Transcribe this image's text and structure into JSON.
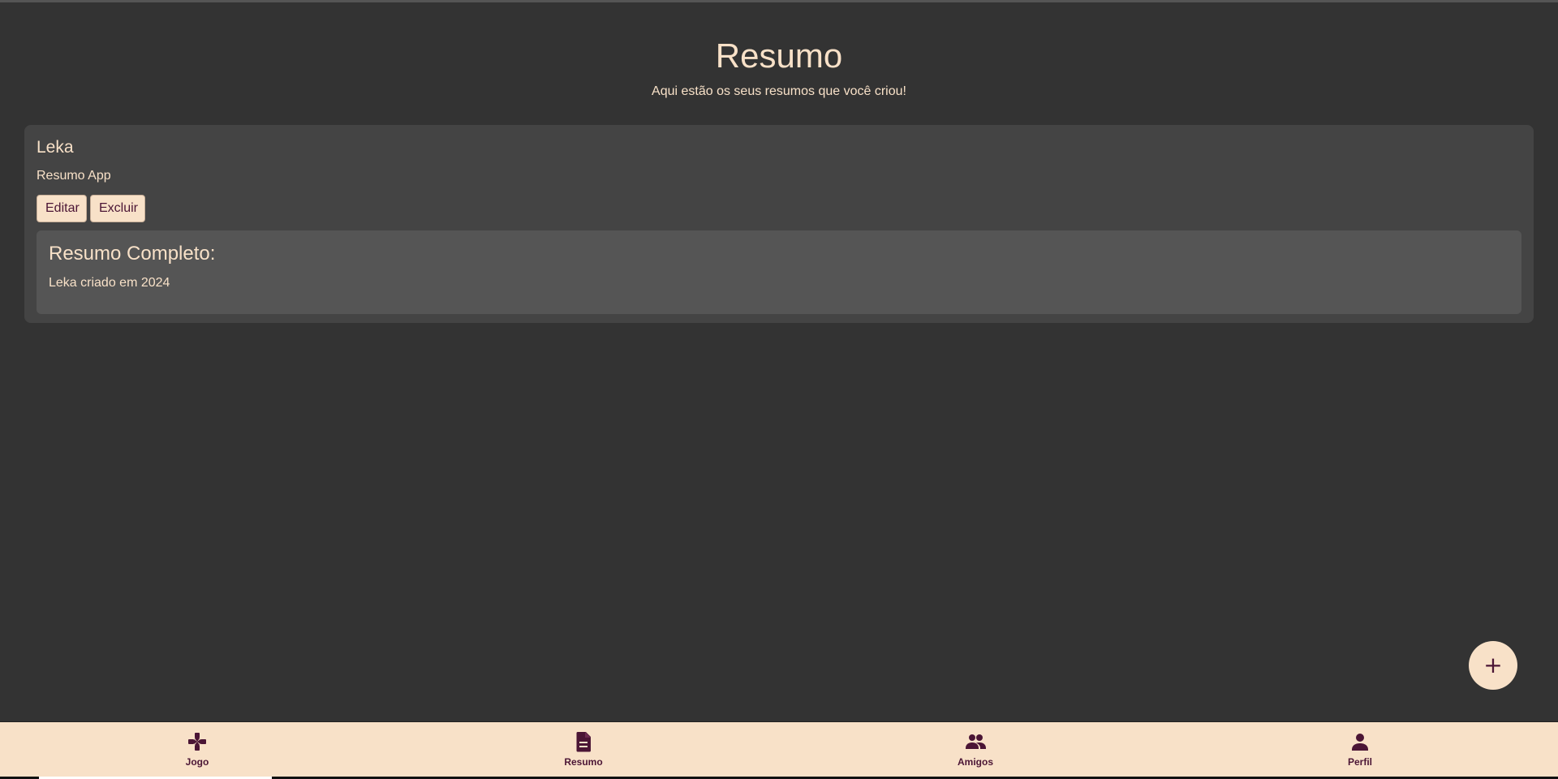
{
  "page": {
    "title": "Resumo",
    "subtitle": "Aqui estão os seus resumos que você criou!"
  },
  "summary_card": {
    "name": "Leka",
    "description": "Resumo App",
    "edit_label": "Editar",
    "delete_label": "Excluir",
    "detail_title": "Resumo Completo:",
    "detail_text": "Leka criado em 2024"
  },
  "fab": {
    "label": "+",
    "icon": "plus-icon"
  },
  "bottom_nav": {
    "items": [
      {
        "label": "Jogo",
        "icon": "gamepad-icon"
      },
      {
        "label": "Resumo",
        "icon": "document-icon"
      },
      {
        "label": "Amigos",
        "icon": "people-icon"
      },
      {
        "label": "Perfil",
        "icon": "person-icon"
      }
    ]
  },
  "colors": {
    "background": "#333333",
    "card": "#444444",
    "detail": "#555555",
    "accent_cream": "#f8e1c8",
    "accent_plum": "#4b1535"
  }
}
